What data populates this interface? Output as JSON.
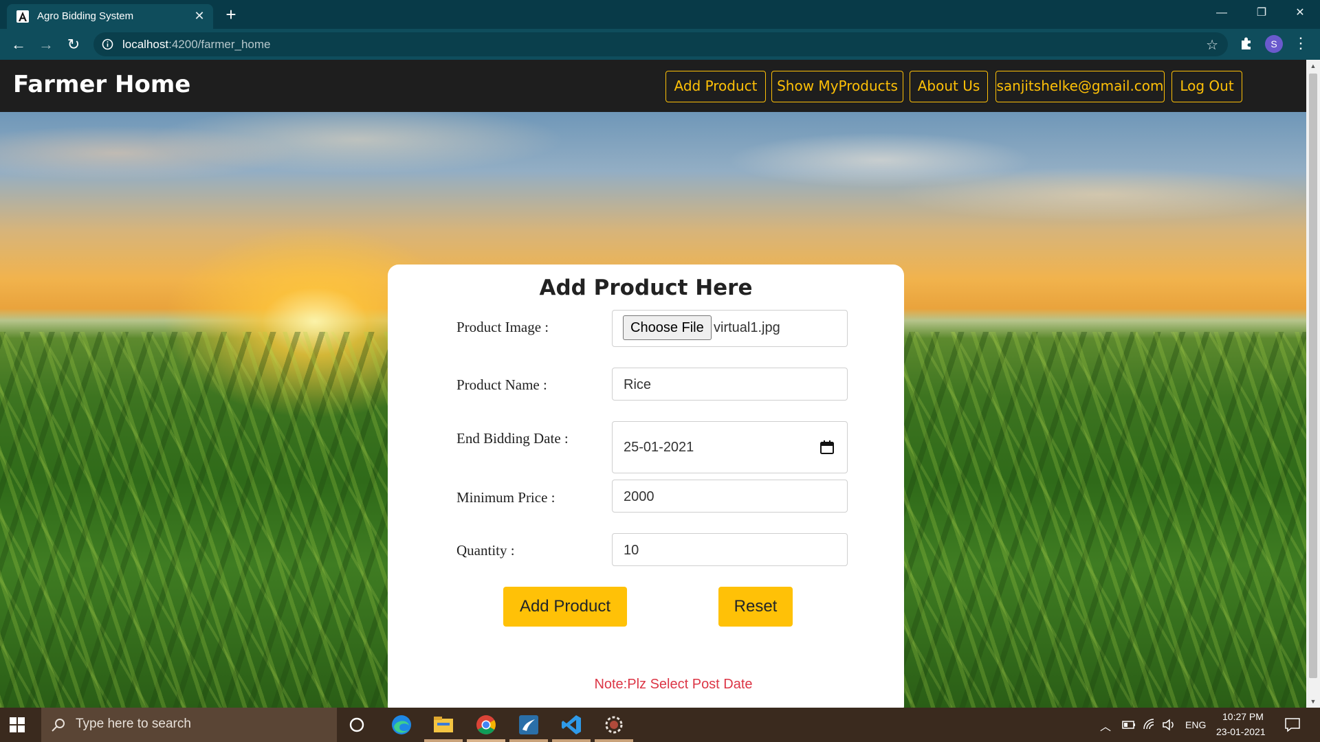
{
  "browser": {
    "tab_title": "Agro Bidding System",
    "url_host": "localhost",
    "url_path": ":4200/farmer_home",
    "profile_initial": "S"
  },
  "navbar": {
    "brand": "Farmer Home",
    "buttons": [
      "Add Product",
      "Show MyProducts",
      "About Us",
      "sanjitshelke@gmail.com",
      "Log Out"
    ]
  },
  "form": {
    "title": "Add Product Here",
    "fields": {
      "image": {
        "label": "Product Image :",
        "button": "Choose File",
        "file": "virtual1.jpg"
      },
      "name": {
        "label": "Product Name :",
        "value": "Rice"
      },
      "end_date": {
        "label": "End Bidding Date :",
        "value": "25-01-2021"
      },
      "min_price": {
        "label": "Minimum Price :",
        "value": "2000"
      },
      "quantity": {
        "label": "Quantity :",
        "value": "10"
      }
    },
    "submit_label": "Add Product",
    "reset_label": "Reset",
    "note": "Note:Plz Select Post Date"
  },
  "taskbar": {
    "search_placeholder": "Type here to search",
    "lang": "ENG",
    "time": "10:27 PM",
    "date": "23-01-2021"
  },
  "colors": {
    "navbar_bg": "#1e1e1e",
    "accent_warning": "#ffc107",
    "note_red": "#dc3545",
    "chrome_bg": "#0f4d5c"
  }
}
